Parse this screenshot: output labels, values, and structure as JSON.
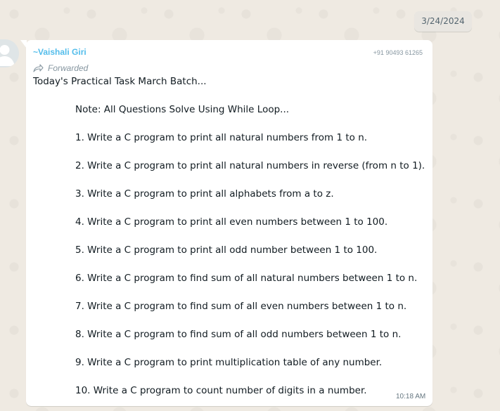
{
  "chat": {
    "date_chip": "3/24/2024"
  },
  "message": {
    "sender_name": "~Vaishali Giri",
    "sender_phone": "+91 90493 61265",
    "forwarded_label": "Forwarded",
    "title_line": "Today's Practical Task March Batch...",
    "note_line": "Note: All Questions Solve Using While Loop...",
    "questions": [
      "1. Write a C program to print all natural numbers from 1 to n.",
      "2. Write a C program to print all natural numbers in reverse (from n to 1).",
      "3. Write a C program to print all alphabets from a to z.",
      "4. Write a C program to print all even numbers between 1 to 100.",
      "5. Write a C program to print all odd number between 1 to 100.",
      "6. Write a C program to find sum of all natural numbers between 1 to n.",
      "7. Write a C program to find sum of all even numbers between 1 to n.",
      "8. Write a C program to find sum of all odd numbers between 1 to n.",
      "9. Write a C program to print multiplication table of any number.",
      "10. Write a C program to count number of digits in a number."
    ],
    "time": "10:18 AM"
  },
  "colors": {
    "wallpaper": "#efeae2",
    "bubble": "#ffffff",
    "sender_name": "#53bdeb",
    "meta_text": "#8696a0",
    "body_text": "#111b21"
  },
  "icons": {
    "avatar": "default-avatar-icon",
    "forwarded": "forward-arrow-icon"
  }
}
